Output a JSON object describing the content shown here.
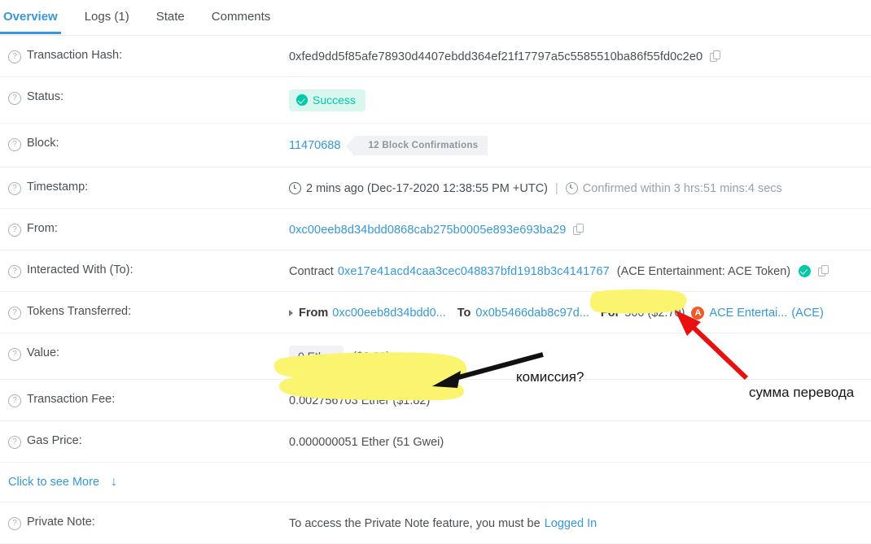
{
  "tabs": [
    {
      "label": "Overview",
      "active": true
    },
    {
      "label": "Logs (1)",
      "active": false
    },
    {
      "label": "State",
      "active": false
    },
    {
      "label": "Comments",
      "active": false
    }
  ],
  "rows": {
    "txhash": {
      "label": "Transaction Hash:",
      "value": "0xfed9dd5f85afe78930d4407ebdd364ef21f17797a5c5585510ba86f55fd0c2e0",
      "copy_icon": "copy-icon"
    },
    "status": {
      "label": "Status:",
      "badge": "Success",
      "badge_bg": "#d9f7ef",
      "badge_color": "#00c9a7",
      "icon": "check-circle-icon"
    },
    "block": {
      "label": "Block:",
      "number": "11470688",
      "confirmations": "12 Block Confirmations"
    },
    "timestamp": {
      "label": "Timestamp:",
      "ago": "2 mins ago (Dec-17-2020 12:38:55 PM +UTC)",
      "separator": "|",
      "confirmed_within": "Confirmed within 3 hrs:51 mins:4 secs",
      "icon": "clock-icon"
    },
    "from": {
      "label": "From:",
      "address": "0xc00eeb8d34bdd0868cab275b0005e893e693ba29"
    },
    "to": {
      "label": "Interacted With (To):",
      "prefix": "Contract",
      "address": "0xe17e41acd4caa3cec048837bfd1918b3c4141767",
      "name": "(ACE Entertainment: ACE Token)",
      "verified_icon": "verified-check-icon"
    },
    "tokens": {
      "label": "Tokens Transferred:",
      "from_label": "From",
      "from_address": "0xc00eeb8d34bdd0...",
      "to_label": "To",
      "to_address": "0x0b5466dab8c97d...",
      "for_label": "For",
      "amount": "500 ($2.70)",
      "token_logo_letter": "A",
      "token_name": "ACE Entertai...",
      "token_symbol": "(ACE)",
      "expand_icon": "caret-right-icon"
    },
    "value": {
      "label": "Value:",
      "ether": "0 Ether",
      "usd": "($0.00)"
    },
    "fee": {
      "label": "Transaction Fee:",
      "value": "0.002756703 Ether ($1.82)"
    },
    "gas_price": {
      "label": "Gas Price:",
      "value": "0.000000051 Ether (51 Gwei)"
    },
    "see_more": {
      "label": "Click to see More",
      "arrow": "↓"
    },
    "private_note": {
      "label": "Private Note:",
      "text": "To access the Private Note feature, you must be",
      "link": "Logged In"
    }
  },
  "annotations": {
    "highlight_color": "#faf46e",
    "fee_note": "комиссия?",
    "fee_note_arrow_color": "#000000",
    "amount_note": "сумма перевода",
    "amount_note_arrow_color": "#e8110f"
  }
}
